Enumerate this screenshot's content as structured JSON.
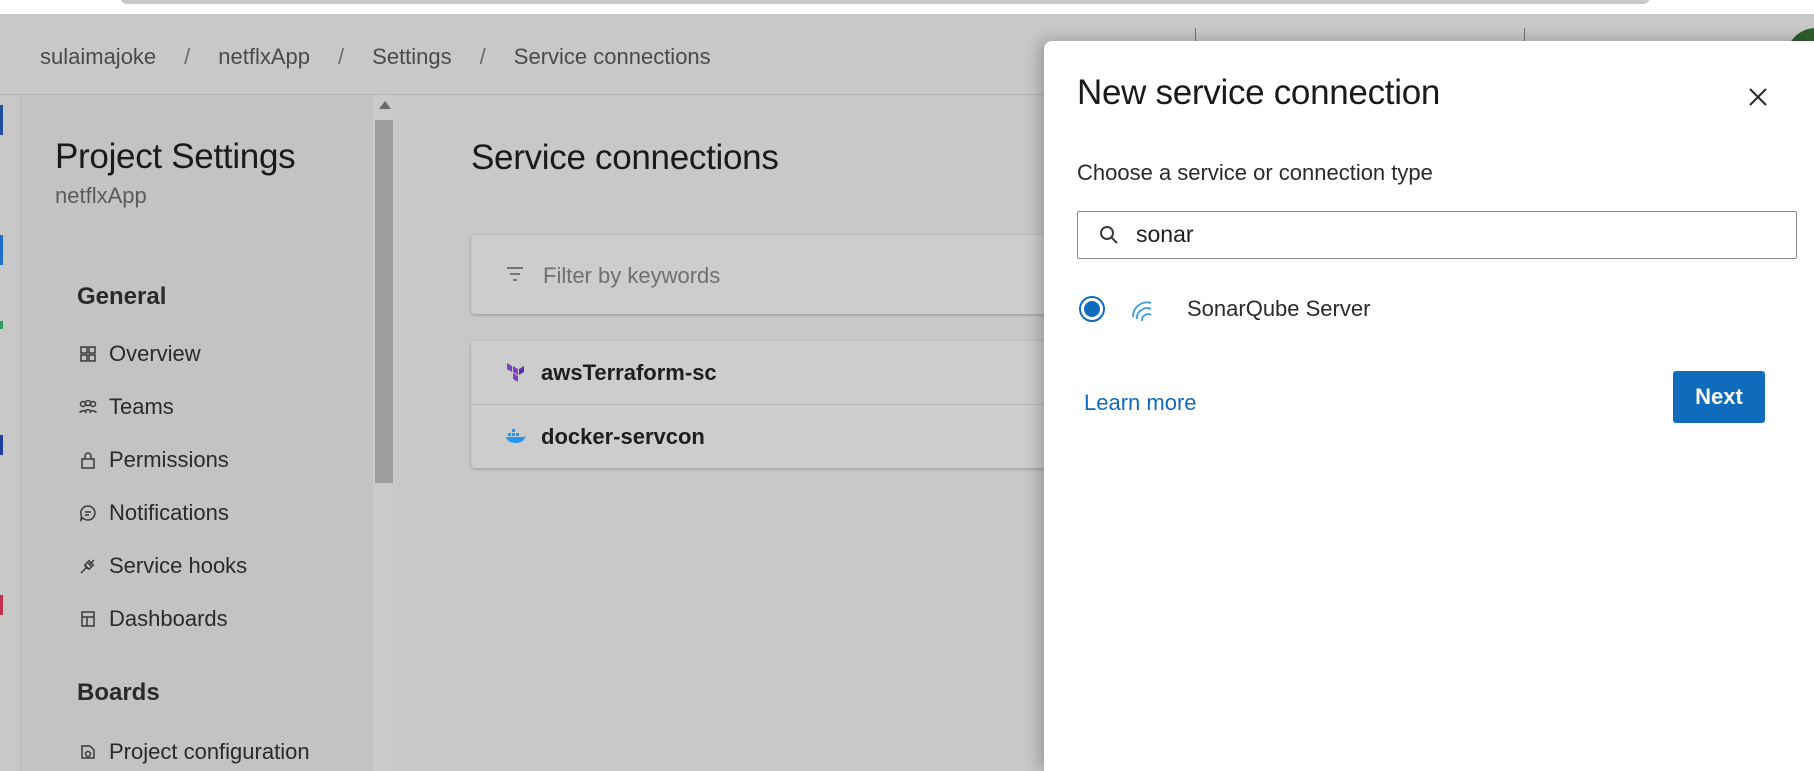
{
  "breadcrumb": [
    "sulaimajoke",
    "netflxApp",
    "Settings",
    "Service connections"
  ],
  "sidebar": {
    "title": "Project Settings",
    "subtitle": "netflxApp",
    "sections": [
      {
        "heading": "General",
        "items": [
          {
            "label": "Overview",
            "icon": "overview-icon"
          },
          {
            "label": "Teams",
            "icon": "teams-icon"
          },
          {
            "label": "Permissions",
            "icon": "lock-icon"
          },
          {
            "label": "Notifications",
            "icon": "notification-icon"
          },
          {
            "label": "Service hooks",
            "icon": "service-hooks-icon"
          },
          {
            "label": "Dashboards",
            "icon": "dashboards-icon"
          }
        ]
      },
      {
        "heading": "Boards",
        "items": [
          {
            "label": "Project configuration",
            "icon": "project-config-icon"
          }
        ]
      }
    ]
  },
  "main": {
    "title": "Service connections",
    "filter_placeholder": "Filter by keywords",
    "connections": [
      {
        "name": "awsTerraform-sc",
        "icon": "terraform-icon"
      },
      {
        "name": "docker-servcon",
        "icon": "docker-icon"
      }
    ]
  },
  "panel": {
    "title": "New service connection",
    "subtitle": "Choose a service or connection type",
    "search_value": "sonar",
    "option_label": "SonarQube Server",
    "option_selected": true,
    "learn_more": "Learn more",
    "next_label": "Next"
  },
  "colors": {
    "accent": "#0f6cbd",
    "terraform": "#7b42bc",
    "docker": "#2496ed"
  }
}
